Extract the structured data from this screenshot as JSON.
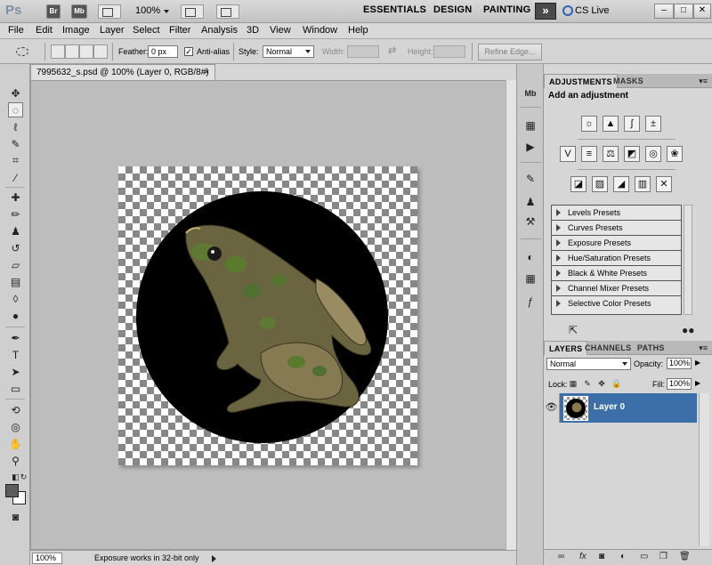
{
  "appbar": {
    "logo": "Ps",
    "bridge": "Br",
    "minibridge": "Mb",
    "zoom": "100%",
    "workspaces": [
      "ESSENTIALS",
      "DESIGN",
      "PAINTING"
    ],
    "more": "»",
    "cs_live": "CS Live",
    "window_buttons": [
      "–",
      "□",
      "✕"
    ]
  },
  "menubar": {
    "items": [
      "File",
      "Edit",
      "Image",
      "Layer",
      "Select",
      "Filter",
      "Analysis",
      "3D",
      "View",
      "Window",
      "Help"
    ]
  },
  "options": {
    "feather_label": "Feather:",
    "feather_value": "0 px",
    "antialias_label": "Anti-alias",
    "antialias_checked": "✓",
    "style_label": "Style:",
    "style_value": "Normal",
    "width_label": "Width:",
    "height_label": "Height:",
    "refine_edge": "Refine Edge..."
  },
  "document": {
    "tab_title": "7995632_s.psd @ 100% (Layer 0, RGB/8#) *",
    "tab_close": "×"
  },
  "status": {
    "zoom": "100%",
    "info": "Exposure works in 32-bit only"
  },
  "adjustments": {
    "tabs": [
      "ADJUSTMENTS",
      "MASKS"
    ],
    "title": "Add an adjustment",
    "presets": [
      "Levels Presets",
      "Curves Presets",
      "Exposure Presets",
      "Hue/Saturation Presets",
      "Black & White Presets",
      "Channel Mixer Presets",
      "Selective Color Presets"
    ]
  },
  "layers": {
    "tabs": [
      "LAYERS",
      "CHANNELS",
      "PATHS"
    ],
    "blend_mode": "Normal",
    "opacity_label": "Opacity:",
    "opacity_value": "100%",
    "lock_label": "Lock:",
    "fill_label": "Fill:",
    "fill_value": "100%",
    "layer_name": "Layer 0"
  },
  "colors": {
    "selected_layer": "#3c6fa8",
    "ui_background": "#d6d6d6",
    "canvas_disc": "#000000"
  }
}
